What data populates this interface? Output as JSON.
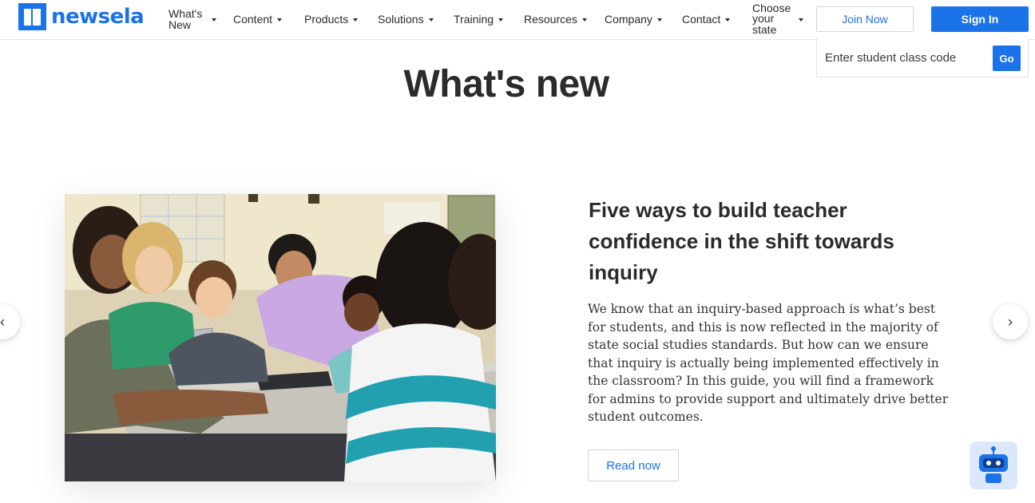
{
  "brand": {
    "name": "newsela",
    "color": "#1a73e8"
  },
  "nav": {
    "items": [
      {
        "label": "What's\nNew"
      },
      {
        "label": "Content"
      },
      {
        "label": "Products"
      },
      {
        "label": "Solutions"
      },
      {
        "label": "Training"
      },
      {
        "label": "Resources"
      },
      {
        "label": "Company"
      },
      {
        "label": "Contact"
      },
      {
        "label": "Choose\nyour\nstate"
      }
    ],
    "join_label": "Join Now",
    "signin_label": "Sign In"
  },
  "class_code": {
    "placeholder": "Enter student class code",
    "go_label": "Go"
  },
  "main": {
    "title": "What's new",
    "article": {
      "title": "Five ways to build teacher confidence in the shift towards inquiry",
      "body": "We know that an inquiry-based approach is what’s best for students, and this is now reflected in the majority of state social studies standards. But how can we ensure that inquiry is actually being implemented effectively in the classroom? In this guide, you will find a framework for admins to provide support and ultimately drive better student outcomes.",
      "cta_label": "Read now"
    },
    "carousel": {
      "prev_icon": "‹",
      "next_icon": "›"
    }
  },
  "icons": {
    "logo": "newsela-book-icon",
    "caret": "caret-down-icon",
    "chat": "chatbot-icon"
  }
}
